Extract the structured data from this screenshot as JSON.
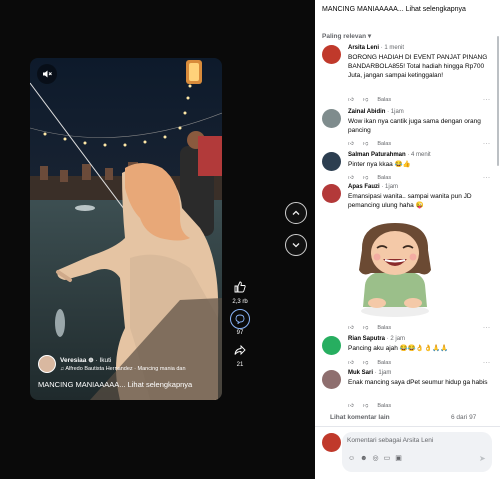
{
  "video": {
    "author": "Veresiaa",
    "follow_label": "· Ikuti",
    "music": "Alfredo Bautista Hernandez · Mancing mania dan",
    "caption": "MANCING MANIAAAAA... Lihat selengkapnya"
  },
  "actions": {
    "likes": "2,3 rb",
    "comments": "97",
    "shares": "21"
  },
  "panel": {
    "title": "MANCING MANIAAAAA... Lihat selengkapnya",
    "sort_label": "Paling relevan",
    "reply_label": "Balas",
    "show_more": "Lihat komentar lain",
    "page_count": "6 dari 97",
    "input_placeholder": "Komentari sebagai Arsita Leni"
  },
  "comments": [
    {
      "name": "Arsita Leni",
      "time": "· 1 menit",
      "text": "BORONG HADIAH DI EVENT PANJAT PINANG BANDARBOLA855! Total hadiah hingga Rp700 Juta, jangan sampai ketinggalan!",
      "reply_time": "",
      "avatar_color": "#c0392b"
    },
    {
      "name": "Zainal Abidin",
      "time": "· 1jam",
      "text": "Wow ikan nya cantik juga sama dengan orang pancing",
      "avatar_color": "#7f8c8d"
    },
    {
      "name": "Salman Paturahman",
      "time": "· 4 menit",
      "text": "Pinter nya kkaa 😂👍",
      "avatar_color": "#2c3e50"
    },
    {
      "name": "Apas Fauzi",
      "time": "· 1jam",
      "text": "Emansipasi wanita.. sampai wanita pun JD pemancing ulung haha 😜",
      "avatar_color": "#b33939"
    },
    {
      "name": "Rian Saputra",
      "time": "· 2 jam",
      "text": "Pancing aku ajah 😂😂👌👌🙏🙏",
      "avatar_color": "#27ae60"
    },
    {
      "name": "Muk Sari",
      "time": "· 1jam",
      "text": "Enak mancing saya dPet seumur hidup ga habis",
      "avatar_color": "#8e6e6e"
    }
  ],
  "colors": {
    "accent": "#8ab4f8",
    "panel_bg": "#ffffff",
    "muted": "#65676b"
  }
}
